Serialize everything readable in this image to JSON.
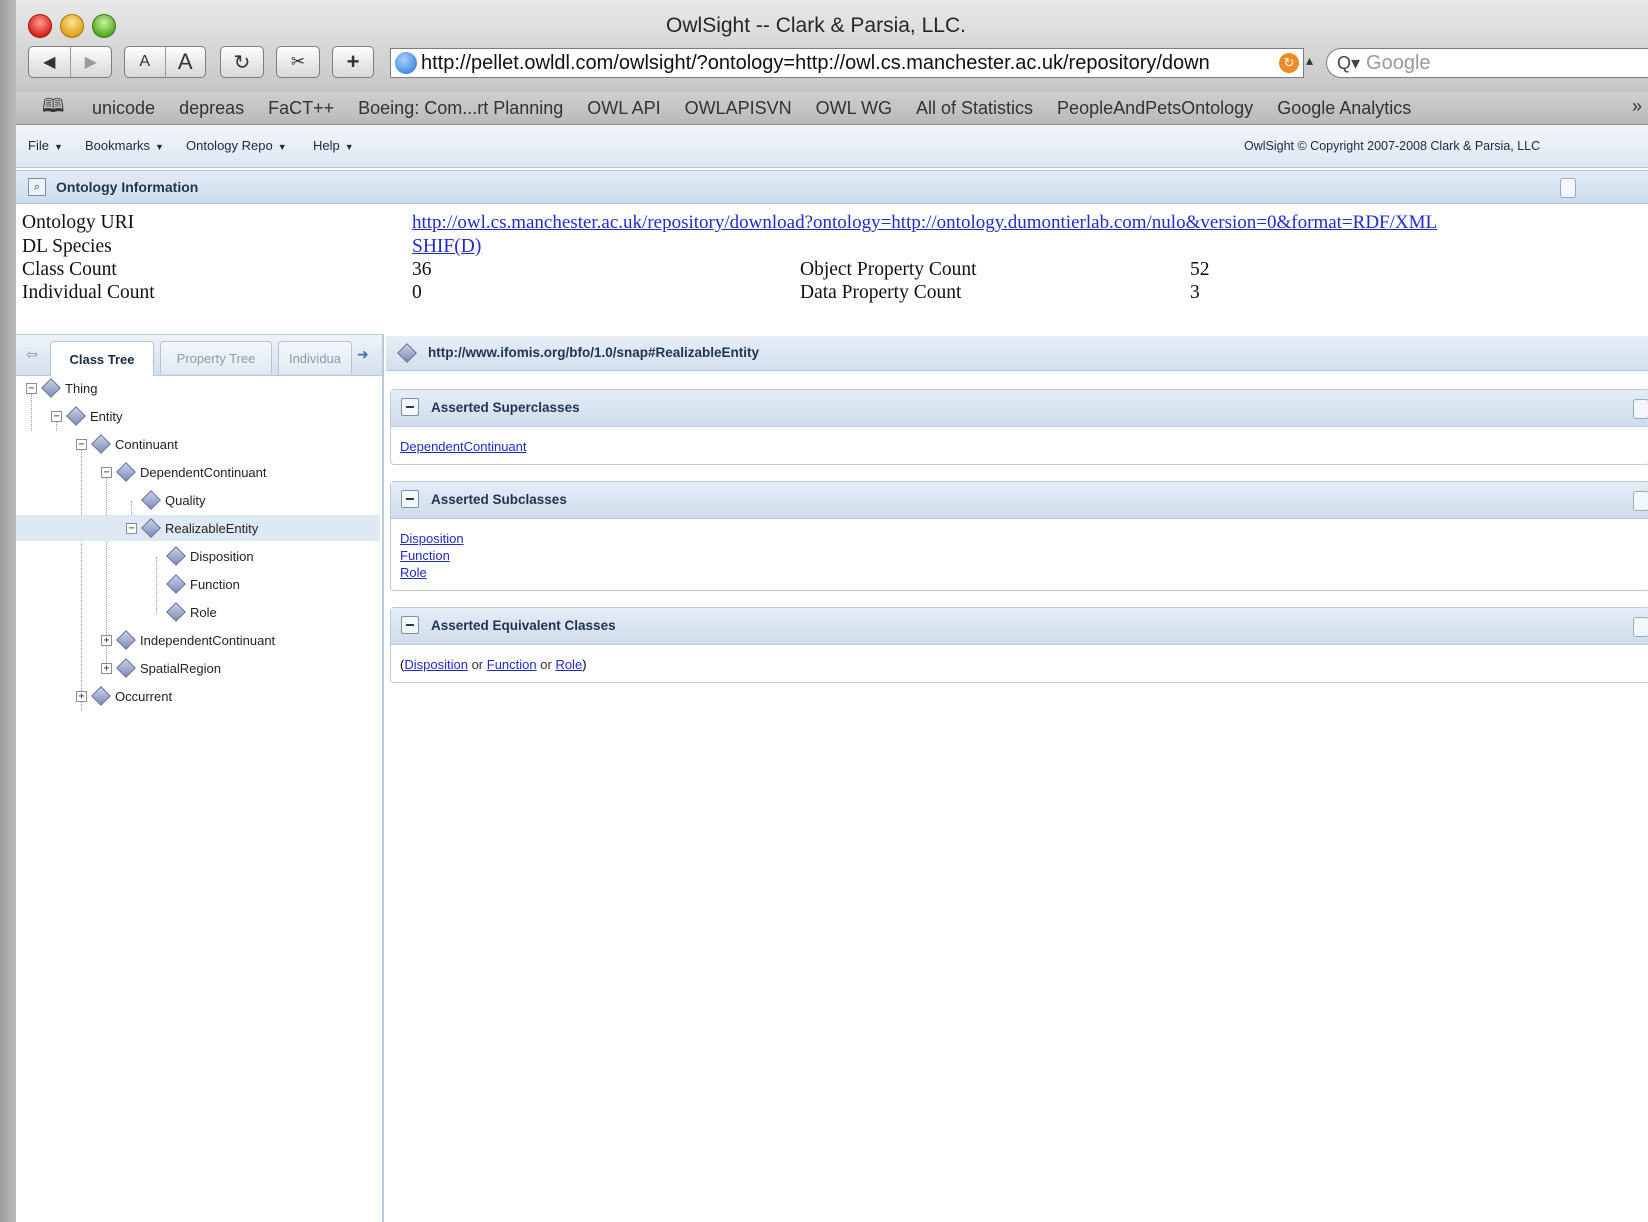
{
  "window": {
    "title": "OwlSight -- Clark & Parsia, LLC."
  },
  "toolbar": {
    "back_icon": "back-arrow-icon",
    "forward_icon": "forward-arrow-icon",
    "text_smaller": "A",
    "text_larger": "A",
    "reload_icon": "reload-icon",
    "snippet_icon": "scissors-icon",
    "add_icon": "plus-icon",
    "url": "http://pellet.owldl.com/owlsight/?ontology=http://owl.cs.manchester.ac.uk/repository/down",
    "search_placeholder": "Google"
  },
  "bookmarks": [
    "unicode",
    "depreas",
    "FaCT++",
    "Boeing: Com...rt Planning",
    "OWL API",
    "OWLAPISVN",
    "OWL WG",
    "All of Statistics",
    "PeopleAndPetsOntology",
    "Google Analytics"
  ],
  "menu": {
    "items": [
      "File",
      "Bookmarks",
      "Ontology Repo",
      "Help"
    ],
    "copyright": "OwlSight © Copyright 2007-2008 Clark & Parsia, LLC"
  },
  "ontology_info": {
    "title": "Ontology Information",
    "uri_label": "Ontology URI",
    "uri_value": "http://owl.cs.manchester.ac.uk/repository/download?ontology=http://ontology.dumontierlab.com/nulo&version=0&format=RDF/XML",
    "dl_label": "DL Species",
    "dl_value": "SHIF(D)",
    "class_count_label": "Class Count",
    "class_count": "36",
    "individual_count_label": "Individual Count",
    "individual_count": "0",
    "object_property_label": "Object Property Count",
    "object_property_count": "52",
    "data_property_label": "Data Property Count",
    "data_property_count": "3"
  },
  "tabs": [
    "Class Tree",
    "Property Tree",
    "Individua"
  ],
  "tree": [
    {
      "label": "Thing",
      "expander": "−"
    },
    {
      "label": "Entity",
      "expander": "−"
    },
    {
      "label": "Continuant",
      "expander": "−"
    },
    {
      "label": "DependentContinuant",
      "expander": "−"
    },
    {
      "label": "Quality",
      "expander": ""
    },
    {
      "label": "RealizableEntity",
      "expander": "−",
      "selected": true
    },
    {
      "label": "Disposition",
      "expander": ""
    },
    {
      "label": "Function",
      "expander": ""
    },
    {
      "label": "Role",
      "expander": ""
    },
    {
      "label": "IndependentContinuant",
      "expander": "+"
    },
    {
      "label": "SpatialRegion",
      "expander": "+"
    },
    {
      "label": "Occurrent",
      "expander": "+"
    }
  ],
  "entity": {
    "uri": "http://www.ifomis.org/bfo/1.0/snap#RealizableEntity",
    "superclasses_title": "Asserted Superclasses",
    "superclasses": [
      "DependentContinuant"
    ],
    "subclasses_title": "Asserted Subclasses",
    "subclasses": [
      "Disposition",
      "Function",
      "Role"
    ],
    "equivalent_title": "Asserted Equivalent Classes",
    "equivalent": {
      "open": "(",
      "items": [
        "Disposition",
        "Function",
        "Role"
      ],
      "operator": "or",
      "close": ")"
    }
  }
}
